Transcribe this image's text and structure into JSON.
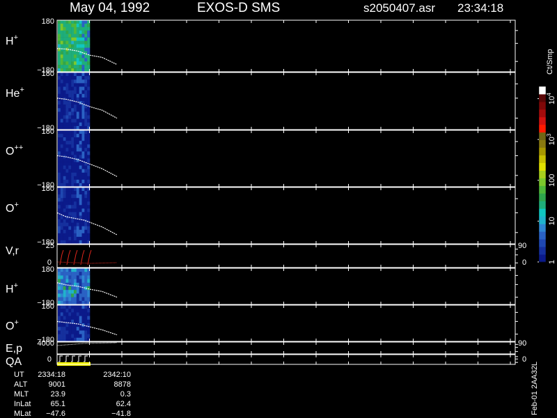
{
  "header": {
    "date": "May 04, 1992",
    "instrument": "EXOS-D SMS",
    "file": "s2050407.asr",
    "time": "23:34:18"
  },
  "side_label": "Feb-01 2AA32L",
  "colors": {
    "background": "#000000",
    "frame": "#ffffff",
    "trace": "#ffffff",
    "velocity_trace": "#e0261c",
    "qa_bar": "#ffff00"
  },
  "colorbar": {
    "unit": "Ct/Smp",
    "tick_labels": [
      {
        "value": 1,
        "main": "1",
        "sup": ""
      },
      {
        "value": 10,
        "main": "10",
        "sup": ""
      },
      {
        "value": 100,
        "main": "100",
        "sup": ""
      },
      {
        "value": 1000,
        "main": "10",
        "sup": "3"
      },
      {
        "value": 10000,
        "main": "10",
        "sup": "4"
      }
    ],
    "scale": "log",
    "range": [
      1,
      20000
    ],
    "colors": [
      "#0b1a8a",
      "#15309e",
      "#1f48b2",
      "#2a62c4",
      "#2f86d2",
      "#20b3cc",
      "#10c7c0",
      "#1fae7a",
      "#2fa64d",
      "#4fb83a",
      "#7cc82c",
      "#a8cf1d",
      "#e0e000",
      "#c9c000",
      "#a89800",
      "#8a7a10",
      "#6f6615",
      "#ff1a00",
      "#d21210",
      "#a50c0c",
      "#7e0808",
      "#5a0505",
      "#ffffff"
    ]
  },
  "axis": {
    "time_start": "2334:18",
    "time_end": "2342:10"
  },
  "chart_data": [
    {
      "type": "heatmap",
      "panel": "H+",
      "label_main": "H",
      "label_sup": "+",
      "ylim": [
        -180,
        180
      ],
      "y_top_label": "180",
      "y_bottom_label": "−180",
      "dominant_level": "green",
      "trace": [
        [
          0,
          0.55
        ],
        [
          0.15,
          0.56
        ],
        [
          0.35,
          0.6
        ],
        [
          0.45,
          0.64
        ],
        [
          0.55,
          0.68
        ],
        [
          0.75,
          0.72
        ],
        [
          1.0,
          0.86
        ]
      ]
    },
    {
      "type": "heatmap",
      "panel": "He+",
      "label_main": "He",
      "label_sup": "+",
      "ylim": [
        -180,
        180
      ],
      "y_top_label": "180",
      "y_bottom_label": "−180",
      "dominant_level": "blue",
      "trace": [
        [
          0,
          0.45
        ],
        [
          0.15,
          0.47
        ],
        [
          0.35,
          0.52
        ],
        [
          0.45,
          0.56
        ],
        [
          0.55,
          0.6
        ],
        [
          0.75,
          0.66
        ],
        [
          1.0,
          0.8
        ]
      ]
    },
    {
      "type": "heatmap",
      "panel": "O++",
      "label_main": "O",
      "label_sup": "++",
      "ylim": [
        -180,
        180
      ],
      "y_top_label": "180",
      "y_bottom_label": "−180",
      "dominant_level": "blue",
      "trace": [
        [
          0,
          0.45
        ],
        [
          0.15,
          0.47
        ],
        [
          0.35,
          0.52
        ],
        [
          0.45,
          0.56
        ],
        [
          0.55,
          0.6
        ],
        [
          0.75,
          0.68
        ],
        [
          1.0,
          0.82
        ]
      ]
    },
    {
      "type": "heatmap",
      "panel": "O+",
      "label_main": "O",
      "label_sup": "+",
      "ylim": [
        -180,
        180
      ],
      "y_top_label": "180",
      "y_bottom_label": "−180",
      "dominant_level": "blue",
      "trace": [
        [
          0,
          0.45
        ],
        [
          0.15,
          0.52
        ],
        [
          0.35,
          0.56
        ],
        [
          0.45,
          0.58
        ],
        [
          0.55,
          0.62
        ],
        [
          0.75,
          0.7
        ],
        [
          1.0,
          0.84
        ]
      ]
    },
    {
      "type": "line",
      "panel": "V,r",
      "label_main": "V,r",
      "ylim": [
        0,
        25
      ],
      "y_top_label": "25",
      "y_zero_label": "0",
      "right_top_label": "90",
      "right_bottom_label": "0"
    },
    {
      "type": "heatmap",
      "panel": "H+ (2)",
      "label_main": "H",
      "label_sup": "+",
      "ylim": [
        -180,
        180
      ],
      "y_top_label": "180",
      "y_bottom_label": "−180",
      "dominant_level": "cyan",
      "trace": [
        [
          0,
          0.4
        ],
        [
          0.15,
          0.46
        ],
        [
          0.35,
          0.5
        ],
        [
          0.45,
          0.54
        ],
        [
          0.55,
          0.58
        ],
        [
          0.75,
          0.64
        ],
        [
          1.0,
          0.8
        ]
      ]
    },
    {
      "type": "heatmap",
      "panel": "O+ (2)",
      "label_main": "O",
      "label_sup": "+",
      "ylim": [
        -180,
        180
      ],
      "y_top_label": "180",
      "y_bottom_label": "−180",
      "dominant_level": "blue",
      "trace": [
        [
          0,
          0.45
        ],
        [
          0.15,
          0.48
        ],
        [
          0.35,
          0.52
        ],
        [
          0.45,
          0.56
        ],
        [
          0.55,
          0.6
        ],
        [
          0.75,
          0.68
        ],
        [
          1.0,
          0.82
        ]
      ]
    },
    {
      "type": "line",
      "panel": "E,p",
      "label_main": "E,p",
      "ylim": [
        0,
        4000
      ],
      "y_top_label": "4000",
      "right_top_label": "90"
    },
    {
      "type": "line",
      "panel": "QA",
      "label_main": "QA",
      "y_zero_label": "0",
      "right_bottom_label": "0"
    }
  ],
  "orbit_table": {
    "rows": [
      {
        "label": "UT",
        "v1": "2334:18",
        "v2": "2342:10"
      },
      {
        "label": "ALT",
        "v1": "9001",
        "v2": "8878"
      },
      {
        "label": "MLT",
        "v1": "23.9",
        "v2": "0.3"
      },
      {
        "label": "InLat",
        "v1": "65.1",
        "v2": "62.4"
      },
      {
        "label": "MLat",
        "v1": "−47.6",
        "v2": "−41.8"
      }
    ]
  }
}
